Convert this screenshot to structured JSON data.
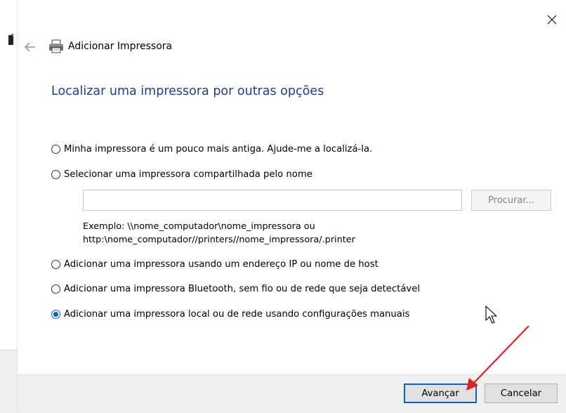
{
  "window": {
    "title": "Adicionar Impressora",
    "heading": "Localizar uma impressora por outras opções"
  },
  "options": [
    {
      "label": "Minha impressora é um pouco mais antiga. Ajude-me a localizá-la.",
      "selected": false
    },
    {
      "label": "Selecionar uma impressora compartilhada pelo nome",
      "selected": false
    },
    {
      "label": "Adicionar uma impressora usando um endereço IP ou nome de host",
      "selected": false
    },
    {
      "label": "Adicionar uma impressora Bluetooth, sem fio ou de rede que seja detectável",
      "selected": false
    },
    {
      "label": "Adicionar uma impressora local ou de rede usando configurações manuais",
      "selected": true
    }
  ],
  "shared_name": {
    "value": "",
    "browse_label": "Procurar...",
    "example_line1": "Exemplo: \\\\nome_computador\\nome_impressora ou",
    "example_line2": "http:\\nome_computador//printers//nome_impressora/.printer"
  },
  "footer": {
    "next_label": "Avançar",
    "cancel_label": "Cancelar"
  },
  "colors": {
    "heading": "#1e3e9a",
    "accent": "#0a64c8",
    "annotation_arrow": "#e02020"
  },
  "icons": [
    "close-icon",
    "back-arrow-icon",
    "printer-icon",
    "mouse-cursor-icon"
  ]
}
